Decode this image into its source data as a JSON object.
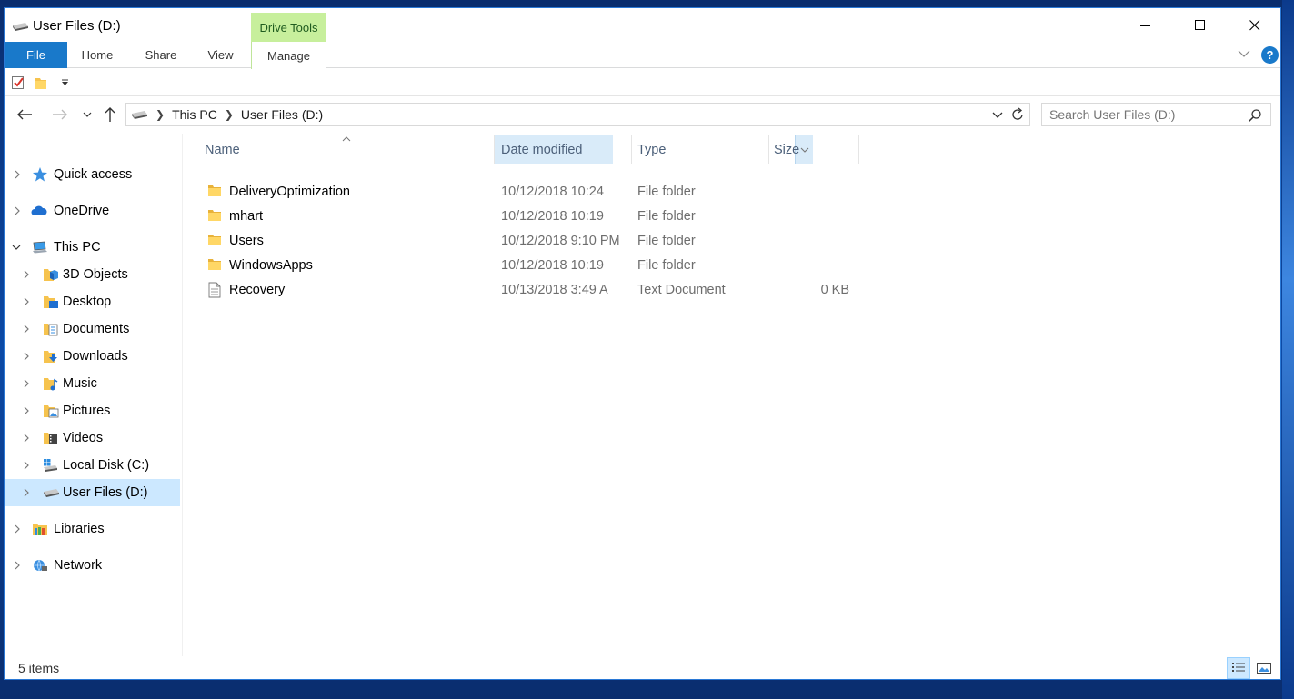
{
  "window": {
    "title": "User Files (D:)",
    "minimize_icon": "minimize-icon",
    "maximize_icon": "maximize-icon",
    "close_icon": "close-icon"
  },
  "ribbon": {
    "contextual_header": "Drive Tools",
    "tabs": [
      {
        "label": "File"
      },
      {
        "label": "Home"
      },
      {
        "label": "Share"
      },
      {
        "label": "View"
      },
      {
        "label": "Manage"
      }
    ],
    "help_label": "?"
  },
  "quick_access_toolbar": {
    "items": [
      "properties-icon",
      "new-folder-icon",
      "customize-dropdown-icon"
    ]
  },
  "address_bar": {
    "segments": [
      "This PC",
      "User Files (D:)"
    ]
  },
  "search": {
    "placeholder": "Search User Files (D:)"
  },
  "nav_pane": {
    "items": [
      {
        "label": "Quick access",
        "icon": "star-icon",
        "expanded": false,
        "level": 0
      },
      {
        "label": "OneDrive",
        "icon": "cloud-icon",
        "expanded": false,
        "level": 0
      },
      {
        "label": "This PC",
        "icon": "computer-icon",
        "expanded": true,
        "level": 0
      },
      {
        "label": "3D Objects",
        "icon": "3d-objects-icon",
        "expanded": false,
        "level": 1
      },
      {
        "label": "Desktop",
        "icon": "desktop-folder-icon",
        "expanded": false,
        "level": 1
      },
      {
        "label": "Documents",
        "icon": "documents-folder-icon",
        "expanded": false,
        "level": 1
      },
      {
        "label": "Downloads",
        "icon": "downloads-folder-icon",
        "expanded": false,
        "level": 1
      },
      {
        "label": "Music",
        "icon": "music-folder-icon",
        "expanded": false,
        "level": 1
      },
      {
        "label": "Pictures",
        "icon": "pictures-folder-icon",
        "expanded": false,
        "level": 1
      },
      {
        "label": "Videos",
        "icon": "videos-folder-icon",
        "expanded": false,
        "level": 1
      },
      {
        "label": "Local Disk (C:)",
        "icon": "windows-drive-icon",
        "expanded": false,
        "level": 1
      },
      {
        "label": "User Files (D:)",
        "icon": "drive-icon",
        "expanded": false,
        "level": 1,
        "selected": true
      },
      {
        "label": "Libraries",
        "icon": "libraries-icon",
        "expanded": false,
        "level": 0
      },
      {
        "label": "Network",
        "icon": "network-icon",
        "expanded": false,
        "level": 0
      }
    ]
  },
  "file_list": {
    "columns": [
      {
        "label": "Name"
      },
      {
        "label": "Date modified",
        "sorted": true
      },
      {
        "label": "Type"
      },
      {
        "label": "Size"
      }
    ],
    "rows": [
      {
        "name": "DeliveryOptimization",
        "date": "10/12/2018 10:24",
        "type": "File folder",
        "size": "",
        "icon": "folder-icon"
      },
      {
        "name": "mhart",
        "date": "10/12/2018 10:19",
        "type": "File folder",
        "size": "",
        "icon": "folder-icon"
      },
      {
        "name": "Users",
        "date": "10/12/2018 9:10 PM",
        "type": "File folder",
        "size": "",
        "icon": "folder-icon"
      },
      {
        "name": "WindowsApps",
        "date": "10/12/2018 10:19",
        "type": "File folder",
        "size": "",
        "icon": "folder-icon"
      },
      {
        "name": "Recovery",
        "date": "10/13/2018 3:49 A",
        "type": "Text Document",
        "size": "0 KB",
        "icon": "text-document-icon"
      }
    ]
  },
  "status_bar": {
    "item_count": "5 items"
  }
}
